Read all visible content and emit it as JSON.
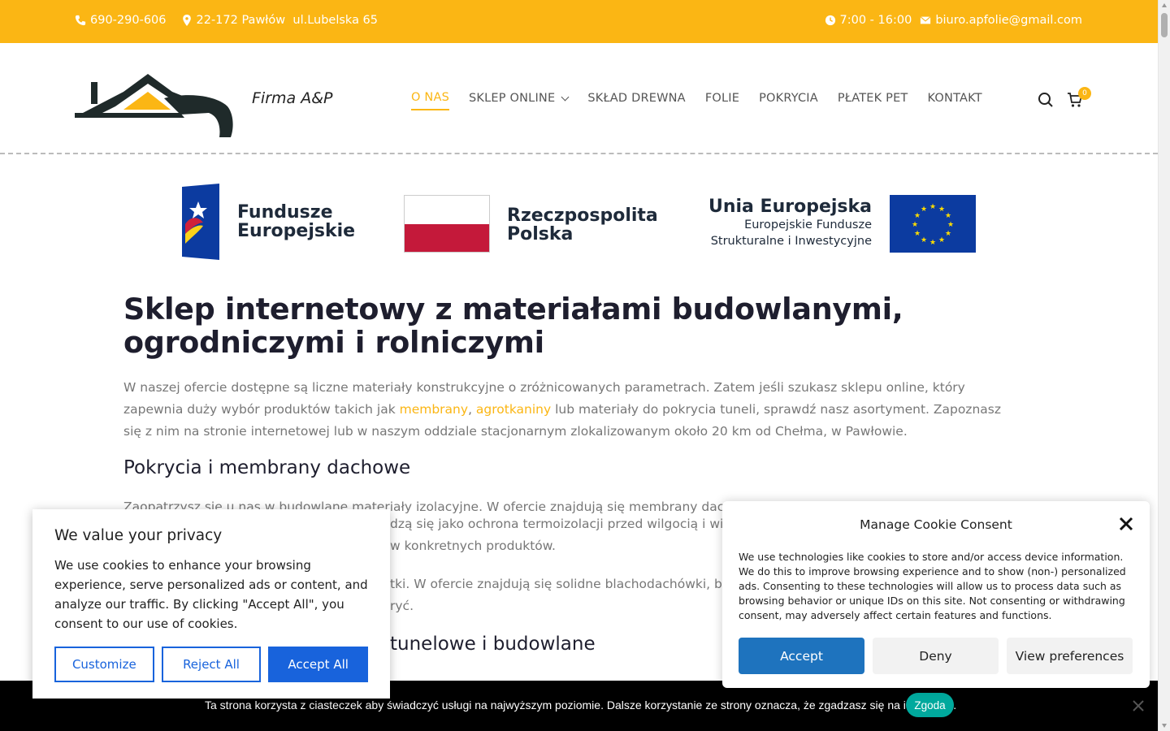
{
  "topbar": {
    "phone": "690-290-606",
    "address": "22-172 Pawłów  ul.Lubelska 65",
    "hours": "7:00 - 16:00",
    "email": "biuro.apfolie@gmail.com"
  },
  "header": {
    "brand": "Firma A&P",
    "nav": [
      {
        "label": "O NAS"
      },
      {
        "label": "SKLEP ONLINE"
      },
      {
        "label": "SKŁAD DREWNA"
      },
      {
        "label": "FOLIE"
      },
      {
        "label": "POKRYCIA"
      },
      {
        "label": "PŁATEK PET"
      },
      {
        "label": "KONTAKT"
      }
    ],
    "cart_count": "0"
  },
  "funds": {
    "fe": [
      "Fundusze",
      "Europejskie"
    ],
    "pl": [
      "Rzeczpospolita",
      "Polska"
    ],
    "ue_title": "Unia Europejska",
    "ue_sub1": "Europejskie Fundusze",
    "ue_sub2": "Strukturalne i Inwestycyjne"
  },
  "content": {
    "title_line1": "Sklep internetowy z materiałami budowlanymi,",
    "title_line2": "ogrodniczymi i rolniczymi",
    "para_a": "W naszej ofercie dostępne są liczne materiały konstrukcyjne o zróżnicowanych parametrach. Zatem jeśli szukasz sklepu online, który zapewnia duży wybór produktów takich jak ",
    "link1": "membrany",
    "sep": ", ",
    "link2": "agrotkaniny",
    "para_b": " lub materiały do pokrycia tuneli, sprawdź nasz asortyment. Zapoznasz się z nim na stronie internetowej lub w naszym oddziale stacjonarnym zlokalizowanym około 20 km od Chełma, w Pawłowie.",
    "h2_1": "Pokrycia i membrany dachowe",
    "para2": "Zaopatrzysz się u nas w budowlane materiały izolacyjne. W ofercie znajdują się membrany dachowe",
    "para2b": "dzą się jako ochrona termoizolacji przed wilgocią i wia",
    "para2c": "w konkretnych produktów.",
    "para3": "tki. W ofercie znajdują się solidne blachodachówki, bla",
    "para3b": "ryć.",
    "h2_2": "tunelowe i budowlane"
  },
  "privacy": {
    "title": "We value your privacy",
    "text": "We use cookies to enhance your browsing experience, serve personalized ads or content, and analyze our traffic. By clicking \"Accept All\", you consent to our use of cookies.",
    "customize": "Customize",
    "reject": "Reject All",
    "accept": "Accept All"
  },
  "consent": {
    "title": "Manage Cookie Consent",
    "text": "We use technologies like cookies to store and/or access device information. We do this to improve browsing experience and to show (non-) personalized ads. Consenting to these technologies will allow us to process data such as browsing behavior or unique IDs on this site. Not consenting or withdrawing consent, may adversely affect certain features and functions.",
    "accept": "Accept",
    "deny": "Deny",
    "prefs": "View preferences"
  },
  "bottombar": {
    "message": "Ta strona korzysta z ciasteczek aby świadczyć usługi na najwyższym poziomie. Dalsze korzystanie ze strony oznacza, że zgadzasz się na ich użycie.",
    "ok": "Zgoda"
  },
  "colors": {
    "accent": "#fbb614",
    "cookie_blue": "#1863dc",
    "consent_blue": "#1e73be",
    "ok_green": "#00a99d"
  }
}
